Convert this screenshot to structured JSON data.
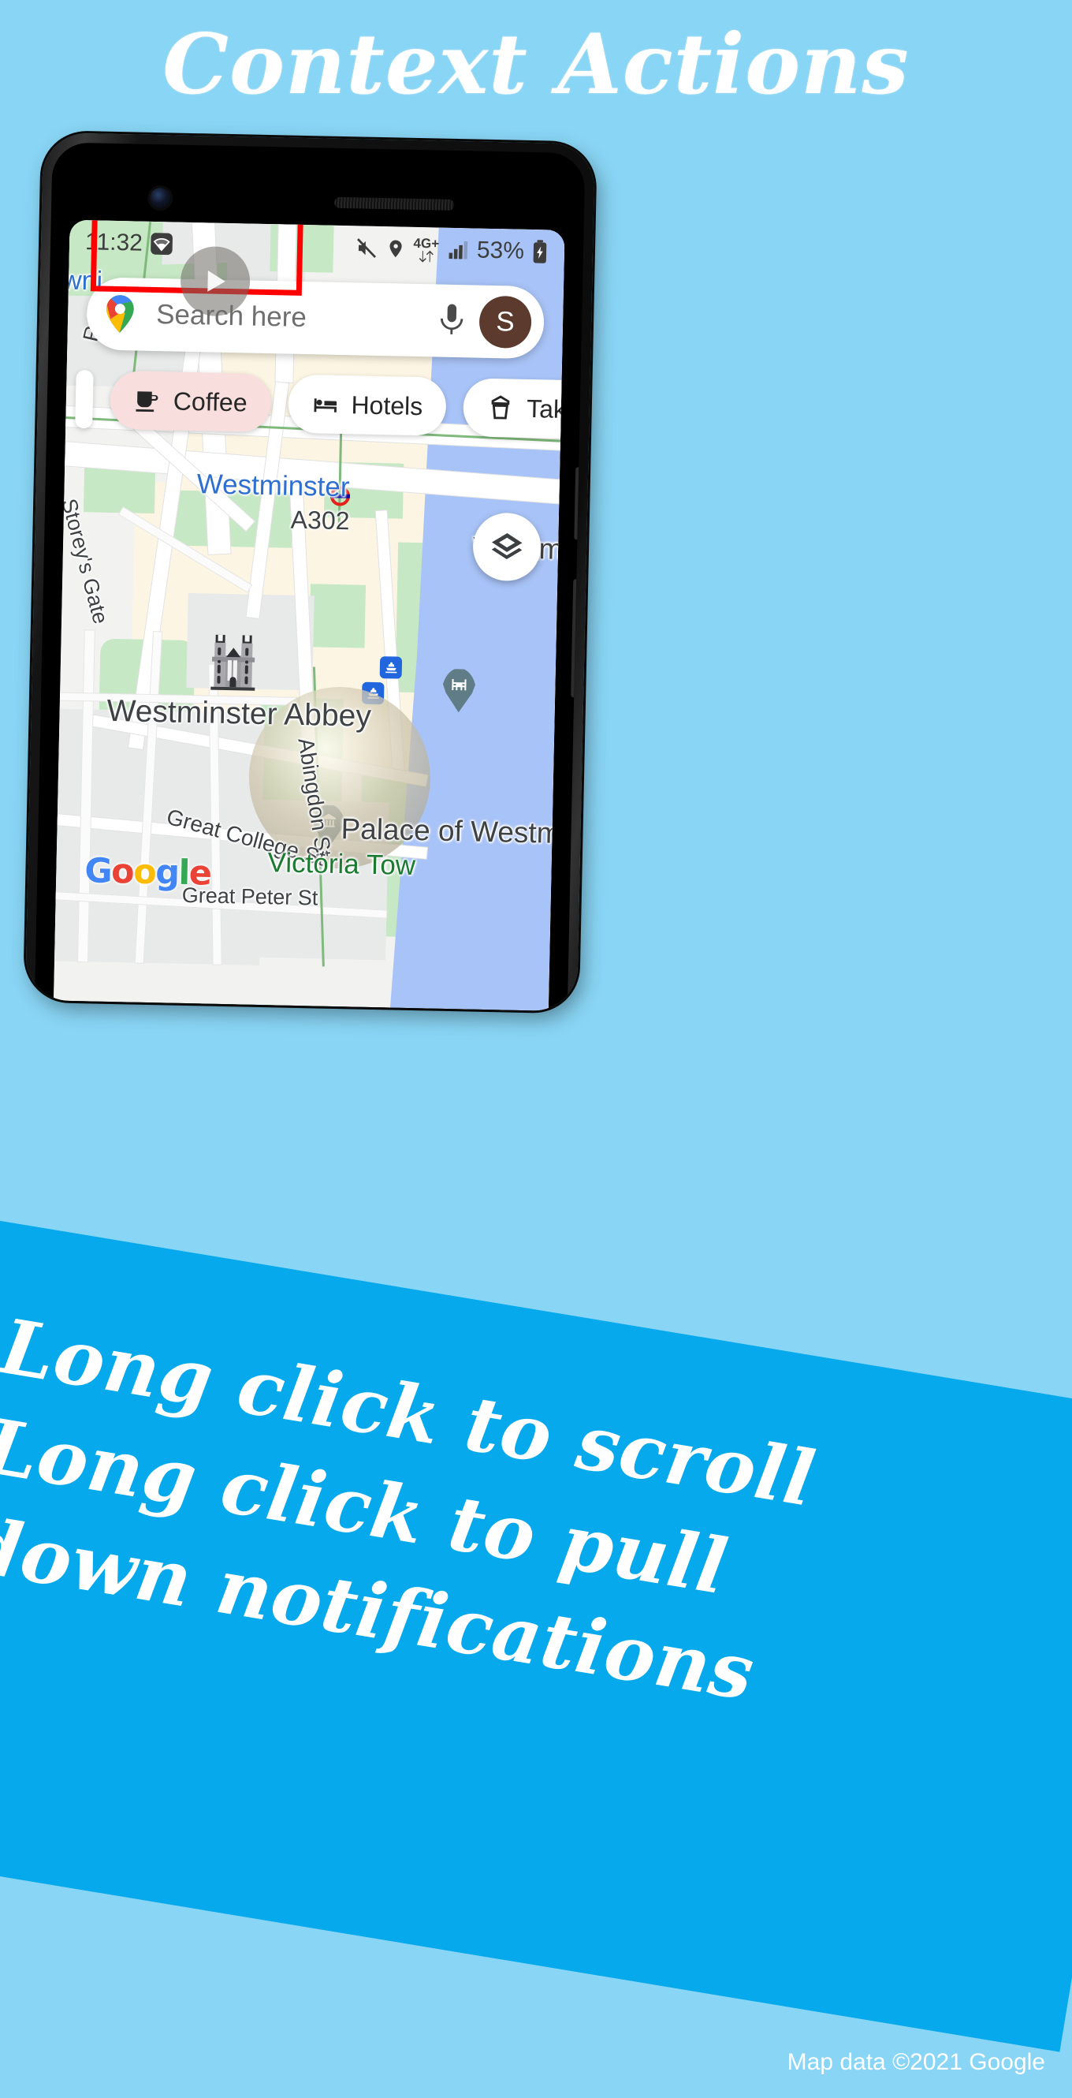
{
  "page": {
    "background_color": "#89d5f5",
    "headline": "Context Actions",
    "attribution": "Map data ©2021 Google"
  },
  "banner": {
    "background_color": "#06a9ec",
    "lines": [
      "Long click to scroll",
      "Long click to pull",
      "down notifications"
    ]
  },
  "phone": {
    "status_bar": {
      "time": "11:32",
      "wifi_icon": "wifi-icon",
      "mute_icon": "volume-mute-icon",
      "location_icon": "location-pin-icon",
      "network_type": "4G+",
      "data_arrows_icon": "data-transfer-icon",
      "signal_icon": "signal-bars-icon",
      "battery_percent": "53%",
      "battery_icon": "battery-charging-icon"
    },
    "search": {
      "logo_icon": "google-maps-pin-icon",
      "placeholder": "Search here",
      "mic_icon": "microphone-icon",
      "avatar_initial": "S"
    },
    "chips": [
      {
        "label": "Coffee",
        "icon": "coffee-cup-icon",
        "highlighted": true,
        "fill": "#f9dede"
      },
      {
        "label": "Hotels",
        "icon": "hotel-bed-icon",
        "highlighted": false,
        "fill": "#ffffff"
      },
      {
        "label": "Takeout",
        "icon": "takeout-box-icon",
        "highlighted": false,
        "fill": "#ffffff"
      },
      {
        "label": "",
        "icon": "pharmacy-icon",
        "highlighted": false,
        "fill": "#ffffff"
      }
    ],
    "highlight_color": "#ff0000",
    "play_overlay_icon": "play-triangle-icon",
    "layers_button": {
      "icon": "map-layers-icon"
    },
    "map": {
      "watermark": "Google",
      "labels": [
        {
          "text": "wni",
          "style": "blue"
        },
        {
          "text": "Westminster",
          "style": "blue"
        },
        {
          "text": "A302",
          "style": "dark"
        },
        {
          "text": "Westmins",
          "style": "dark"
        },
        {
          "text": "Palace of Westminster",
          "style": "dark"
        },
        {
          "text": "Westminster Abbey",
          "style": "dark"
        },
        {
          "text": "Storey's Gate",
          "style": "dark"
        },
        {
          "text": "Abingdon St",
          "style": "dark"
        },
        {
          "text": "Great College St",
          "style": "dark"
        },
        {
          "text": "Great Peter St",
          "style": "dark"
        },
        {
          "text": "Victoria Tow",
          "style": "green"
        },
        {
          "text": "Rd",
          "style": "dark"
        }
      ],
      "markers": [
        {
          "name": "westminster-underground",
          "icon": "tube-roundel-icon"
        },
        {
          "name": "westminster-bridge",
          "icon": "bridge-icon"
        },
        {
          "name": "palace-of-westminster",
          "icon": "museum-icon"
        },
        {
          "name": "westminster-abbey",
          "icon": "abbey-icon"
        },
        {
          "name": "ferry-pier-1",
          "icon": "ferry-icon"
        },
        {
          "name": "ferry-pier-2",
          "icon": "ferry-icon"
        }
      ]
    }
  }
}
